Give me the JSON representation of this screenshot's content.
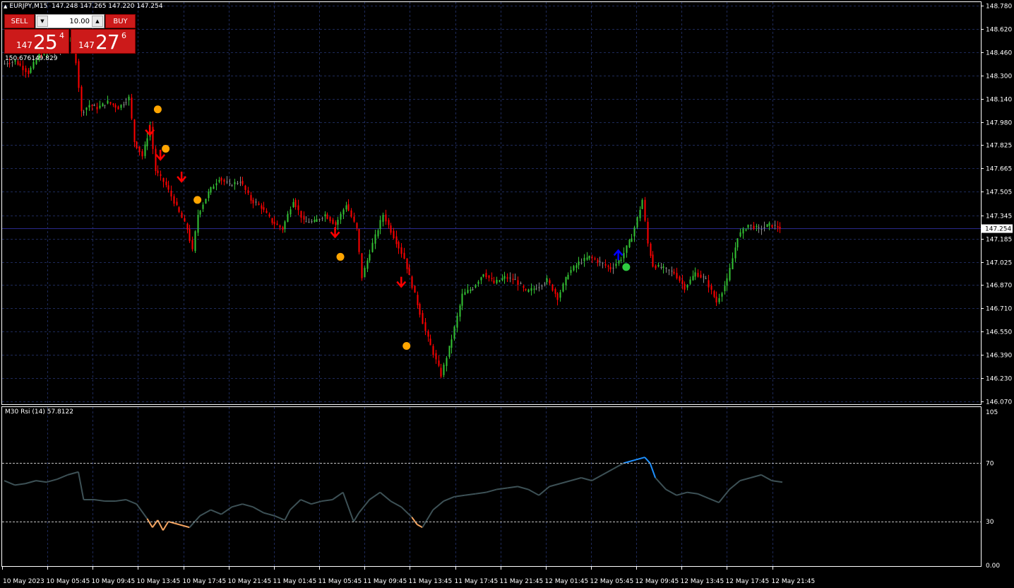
{
  "header": {
    "symbol": "EURJPY,M15",
    "ohlc": "147.248 147.265 147.220 147.254"
  },
  "one_click": {
    "sell_label": "SELL",
    "buy_label": "BUY",
    "lot_value": "10.00",
    "sell_price_prefix": "147",
    "sell_price_big": "25",
    "sell_price_sup": "4",
    "buy_price_prefix": "147",
    "buy_price_big": "27",
    "buy_price_sup": "6"
  },
  "range_text": "150.676149.829",
  "rsi_label": "M30 Rsi (14) 57.8122",
  "colors": {
    "background": "#000000",
    "grid": "#1e2a5a",
    "bull": "#34c434",
    "bear": "#ff0000",
    "neutral": "#8c8c8c",
    "rsi_line": "#3d5156",
    "rsi_low": "#f4a460",
    "rsi_high": "#1e90ff",
    "signal_dot": "#ffa500",
    "buy_dot": "#2ecc40",
    "buy_arrow": "#0000ff",
    "sell_arrow": "#ff0000",
    "bid_line": "#29298c"
  },
  "chart_data": {
    "type": "candlestick",
    "y_ticks": [
      "148.780",
      "148.620",
      "148.460",
      "148.300",
      "148.140",
      "147.980",
      "147.825",
      "147.665",
      "147.505",
      "147.345",
      "147.185",
      "147.025",
      "146.870",
      "146.710",
      "146.550",
      "146.390",
      "146.230",
      "146.070"
    ],
    "ylim": [
      146.07,
      148.78
    ],
    "current_price": "147.254",
    "x_ticks": [
      "10 May 2023",
      "10 May 05:45",
      "10 May 09:45",
      "10 May 13:45",
      "10 May 17:45",
      "10 May 21:45",
      "11 May 01:45",
      "11 May 05:45",
      "11 May 09:45",
      "11 May 13:45",
      "11 May 17:45",
      "11 May 21:45",
      "12 May 01:45",
      "12 May 05:45",
      "12 May 09:45",
      "12 May 13:45",
      "12 May 17:45",
      "12 May 21:45"
    ],
    "price_path": [
      [
        0,
        148.38
      ],
      [
        5,
        148.4
      ],
      [
        10,
        148.32
      ],
      [
        14,
        148.44
      ],
      [
        18,
        148.46
      ],
      [
        22,
        148.48
      ],
      [
        26,
        148.55
      ],
      [
        28,
        148.4
      ],
      [
        30,
        148.05
      ],
      [
        33,
        148.1
      ],
      [
        36,
        148.08
      ],
      [
        40,
        148.12
      ],
      [
        44,
        148.08
      ],
      [
        48,
        148.15
      ],
      [
        50,
        147.85
      ],
      [
        53,
        147.75
      ],
      [
        56,
        147.95
      ],
      [
        58,
        147.65
      ],
      [
        62,
        147.55
      ],
      [
        66,
        147.4
      ],
      [
        70,
        147.25
      ],
      [
        72,
        147.1
      ],
      [
        74,
        147.35
      ],
      [
        78,
        147.5
      ],
      [
        82,
        147.6
      ],
      [
        86,
        147.55
      ],
      [
        90,
        147.58
      ],
      [
        94,
        147.45
      ],
      [
        98,
        147.4
      ],
      [
        102,
        147.3
      ],
      [
        106,
        147.25
      ],
      [
        110,
        147.45
      ],
      [
        114,
        147.3
      ],
      [
        118,
        147.3
      ],
      [
        122,
        147.35
      ],
      [
        126,
        147.28
      ],
      [
        130,
        147.42
      ],
      [
        134,
        147.25
      ],
      [
        136,
        146.92
      ],
      [
        140,
        147.15
      ],
      [
        144,
        147.35
      ],
      [
        148,
        147.2
      ],
      [
        152,
        147.05
      ],
      [
        156,
        146.8
      ],
      [
        160,
        146.55
      ],
      [
        163,
        146.4
      ],
      [
        166,
        146.25
      ],
      [
        170,
        146.5
      ],
      [
        174,
        146.8
      ],
      [
        178,
        146.85
      ],
      [
        182,
        146.95
      ],
      [
        186,
        146.88
      ],
      [
        190,
        146.92
      ],
      [
        194,
        146.9
      ],
      [
        198,
        146.82
      ],
      [
        202,
        146.85
      ],
      [
        206,
        146.9
      ],
      [
        210,
        146.78
      ],
      [
        214,
        146.95
      ],
      [
        218,
        147.02
      ],
      [
        222,
        147.06
      ],
      [
        226,
        147.02
      ],
      [
        230,
        146.98
      ],
      [
        234,
        147.05
      ],
      [
        238,
        147.2
      ],
      [
        242,
        147.45
      ],
      [
        244,
        147.15
      ],
      [
        246,
        147.0
      ],
      [
        250,
        146.98
      ],
      [
        254,
        146.95
      ],
      [
        258,
        146.85
      ],
      [
        262,
        146.95
      ],
      [
        266,
        146.9
      ],
      [
        270,
        146.75
      ],
      [
        274,
        146.9
      ],
      [
        278,
        147.2
      ],
      [
        282,
        147.28
      ],
      [
        286,
        147.25
      ],
      [
        290,
        147.28
      ],
      [
        294,
        147.26
      ]
    ],
    "rsi": {
      "ylim": [
        0,
        105
      ],
      "levels": [
        30,
        70
      ],
      "tick_labels": [
        "105",
        "70",
        "30",
        "0.00"
      ],
      "values": [
        [
          0,
          58
        ],
        [
          4,
          55
        ],
        [
          8,
          56
        ],
        [
          12,
          58
        ],
        [
          16,
          57
        ],
        [
          20,
          59
        ],
        [
          24,
          62
        ],
        [
          28,
          64
        ],
        [
          30,
          45
        ],
        [
          34,
          45
        ],
        [
          38,
          44
        ],
        [
          42,
          44
        ],
        [
          46,
          45
        ],
        [
          50,
          42
        ],
        [
          54,
          32
        ],
        [
          56,
          26
        ],
        [
          58,
          31
        ],
        [
          60,
          24
        ],
        [
          62,
          30
        ],
        [
          66,
          28
        ],
        [
          70,
          26
        ],
        [
          74,
          34
        ],
        [
          78,
          38
        ],
        [
          82,
          35
        ],
        [
          86,
          40
        ],
        [
          90,
          42
        ],
        [
          94,
          40
        ],
        [
          98,
          36
        ],
        [
          102,
          34
        ],
        [
          106,
          31
        ],
        [
          108,
          38
        ],
        [
          112,
          45
        ],
        [
          116,
          42
        ],
        [
          120,
          44
        ],
        [
          124,
          45
        ],
        [
          128,
          50
        ],
        [
          132,
          30
        ],
        [
          134,
          36
        ],
        [
          138,
          45
        ],
        [
          142,
          50
        ],
        [
          146,
          44
        ],
        [
          150,
          40
        ],
        [
          154,
          33
        ],
        [
          156,
          28
        ],
        [
          158,
          26
        ],
        [
          162,
          38
        ],
        [
          166,
          44
        ],
        [
          170,
          47
        ],
        [
          174,
          48
        ],
        [
          178,
          49
        ],
        [
          182,
          50
        ],
        [
          186,
          52
        ],
        [
          190,
          53
        ],
        [
          194,
          54
        ],
        [
          198,
          52
        ],
        [
          202,
          48
        ],
        [
          206,
          54
        ],
        [
          210,
          56
        ],
        [
          214,
          58
        ],
        [
          218,
          60
        ],
        [
          222,
          58
        ],
        [
          226,
          62
        ],
        [
          230,
          66
        ],
        [
          234,
          70
        ],
        [
          238,
          72
        ],
        [
          242,
          74
        ],
        [
          244,
          70
        ],
        [
          246,
          60
        ],
        [
          250,
          52
        ],
        [
          254,
          48
        ],
        [
          258,
          50
        ],
        [
          262,
          49
        ],
        [
          266,
          46
        ],
        [
          270,
          43
        ],
        [
          274,
          52
        ],
        [
          278,
          58
        ],
        [
          282,
          60
        ],
        [
          286,
          62
        ],
        [
          290,
          58
        ],
        [
          294,
          57
        ]
      ]
    },
    "sell_arrows": [
      [
        55,
        147.92
      ],
      [
        59,
        147.75
      ],
      [
        67,
        147.6
      ],
      [
        125,
        147.22
      ],
      [
        150,
        146.88
      ]
    ],
    "buy_arrows": [
      [
        232,
        147.08
      ]
    ],
    "orange_dots": [
      [
        58,
        148.07
      ],
      [
        61,
        147.8
      ],
      [
        73,
        147.45
      ],
      [
        127,
        147.06
      ],
      [
        152,
        146.45
      ]
    ],
    "green_dots": [
      [
        235,
        146.99
      ]
    ]
  }
}
